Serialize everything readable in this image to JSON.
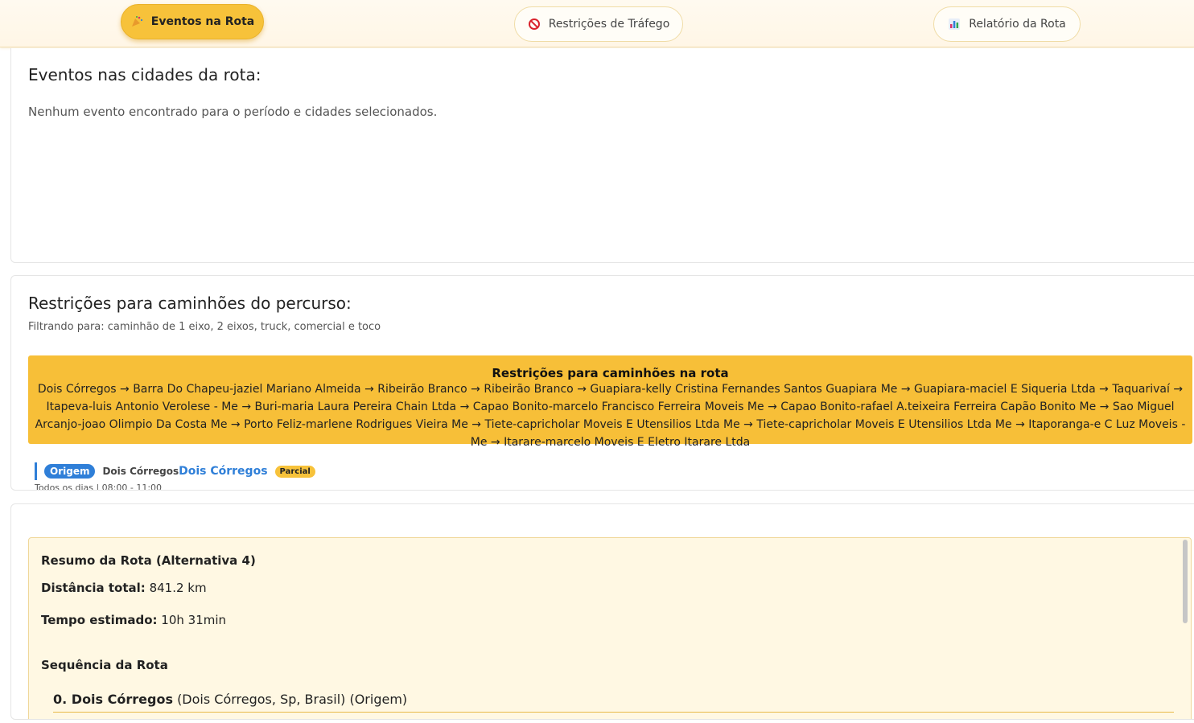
{
  "tabs": {
    "events": {
      "label": "Eventos na Rota",
      "icon": "party-popper-icon"
    },
    "restrictions": {
      "label": "Restrições de Tráfego",
      "icon": "prohibited-icon"
    },
    "report": {
      "label": "Relatório da Rota",
      "icon": "bar-chart-icon"
    }
  },
  "events_section": {
    "title": "Eventos nas cidades da rota:",
    "empty_message": "Nenhum evento encontrado para o período e cidades selecionados."
  },
  "restrictions_section": {
    "title": "Restrições para caminhões do percurso:",
    "filter_text": "Filtrando para: caminhão de 1 eixo, 2 eixos, truck, comercial e toco",
    "box_title": "Restrições para caminhões na rota",
    "box_route": "Dois Córregos → Barra Do Chapeu-jaziel Mariano Almeida → Ribeirão Branco → Ribeirão Branco → Guapiara-kelly Cristina Fernandes Santos Guapiara Me → Guapiara-maciel E Siqueria Ltda → Taquarivaí → Itapeva-luis Antonio Verolese - Me → Buri-maria Laura Pereira Chain Ltda → Capao Bonito-marcelo Francisco Ferreira Moveis Me → Capao Bonito-rafael A.teixeira Ferreira Capão Bonito Me → Sao Miguel Arcanjo-joao Olimpio Da Costa Me → Porto Feliz-marlene Rodrigues Vieira Me → Tiete-capricholar Moveis E Utensilios Ltda Me → Tiete-capricholar Moveis E Utensilios Ltda Me → Itaporanga-e C Luz Moveis - Me → Itarare-marcelo Moveis E Eletro Itarare Ltda",
    "origin": {
      "badge": "Origem",
      "city_small": "Dois Córregos",
      "city_link": "Dois Córregos",
      "status": "Parcial",
      "hours": "Todos os dias | 08:00 - 11:00"
    }
  },
  "report_section": {
    "title": "Resumo da Rota (Alternativa 4)",
    "distance_label": "Distância total:",
    "distance_value": "841.2 km",
    "time_label": "Tempo estimado:",
    "time_value": "10h 31min",
    "sequence_title": "Sequência da Rota",
    "first_step_name": "0. Dois Córregos",
    "first_step_detail": "(Dois Córregos, Sp, Brasil) (Origem)"
  },
  "colors": {
    "accent": "#f7c23a",
    "link": "#2f7fd8",
    "report_bg": "#fff8e3"
  }
}
